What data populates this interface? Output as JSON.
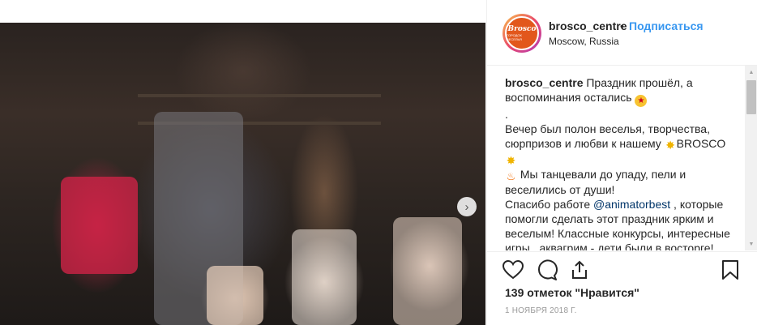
{
  "header": {
    "username": "brosco_centre",
    "separator": "•",
    "follow_label": "Подписаться",
    "location": "Moscow, Russia",
    "avatar_brand": "Brosco",
    "avatar_sub": "ГОРОДОК ВЕСЕЛЬЯ"
  },
  "media": {
    "next_label": "›"
  },
  "caption": {
    "username": "brosco_centre",
    "line1": " Праздник прошёл, а воспоминания остались ",
    "line2": ".",
    "line3": "Вечер был полон веселья, творчества, сюрпризов и любви к нашему ",
    "brand": "BROSCO",
    "line4": " Мы танцевали до упаду, пели и веселились от души!",
    "line5": "Спасибо работе ",
    "mention": "@animatorbest",
    "line6": " , которые помогли сделать этот праздник ярким и веселым! Классные конкурсы, интересные игры , аквагрим - дети были в восторге!"
  },
  "actions": {
    "like_icon": "heart-icon",
    "comment_icon": "comment-icon",
    "share_icon": "share-icon",
    "save_icon": "bookmark-icon"
  },
  "likes": "139 отметок \"Нравится\"",
  "date": "1 НОЯБРЯ 2018 Г.",
  "colors": {
    "link": "#3897f0",
    "text": "#262626",
    "muted": "#999999",
    "avatar_bg": "#e2571c"
  }
}
